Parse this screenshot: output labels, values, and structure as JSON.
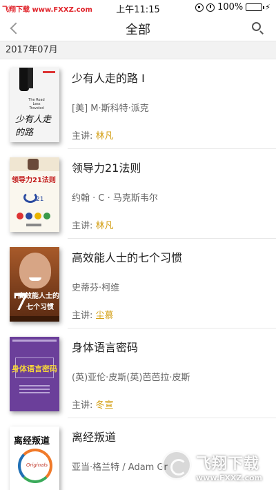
{
  "status_bar": {
    "watermark": "飞翔下载 www.FXXZ.com",
    "time": "上午11:15",
    "battery": "100%",
    "battery_level": 1.0
  },
  "nav": {
    "title": "全部",
    "back_icon": "chevron-left-icon",
    "search_icon": "search-icon"
  },
  "section": {
    "date": "2017年07月"
  },
  "books": [
    {
      "title": "少有人走的路 I",
      "author": "[美] M·斯科特·派克",
      "speaker_label": "主讲:",
      "speaker": "林凡",
      "cover_text": "少有人走的路"
    },
    {
      "title": "领导力21法则",
      "author": "约翰 · C · 马克斯韦尔",
      "speaker_label": "主讲:",
      "speaker": "林凡",
      "cover_text": "领导力21法则"
    },
    {
      "title": "高效能人士的七个习惯",
      "author": "史蒂芬·柯维",
      "speaker_label": "主讲:",
      "speaker": "尘慕",
      "cover_text_1": "高效能人士的",
      "cover_text_2": "七个习惯",
      "cover_num": "7"
    },
    {
      "title": "身体语言密码",
      "author": "(英)亚伦·皮斯(英)芭芭拉·皮斯",
      "speaker_label": "主讲:",
      "speaker": "冬宣",
      "cover_text": "身体语言密码"
    },
    {
      "title": "离经叛道",
      "author": "亚当·格兰特 / Adam Gr",
      "speaker_label": "",
      "speaker": "",
      "cover_text": "离经叛道"
    }
  ],
  "watermark": {
    "title": "飞翔下载",
    "url": "www.FXXZ.com"
  },
  "colors": {
    "speaker_accent": "#d4a017",
    "section_bg": "#f2f2f2",
    "status_watermark": "#e0242b"
  }
}
